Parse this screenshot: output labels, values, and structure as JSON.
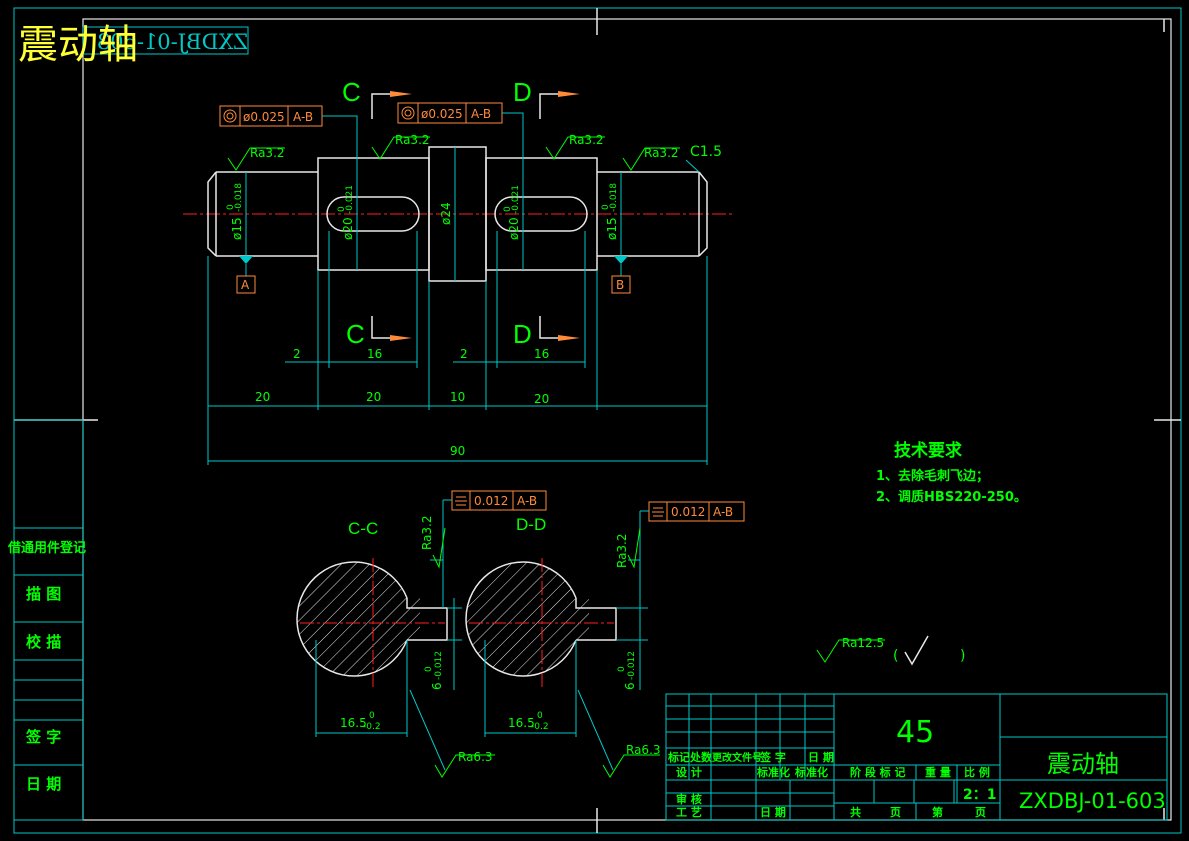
{
  "drawing": {
    "title_overlay": "震动轴",
    "code_mirror": "ZXDBJ-01-603",
    "section_labels": {
      "c": "C",
      "d": "D",
      "cc": "C-C",
      "dd": "D-D"
    },
    "datums": {
      "a": "A",
      "b": "B",
      "ab": "A-B"
    },
    "tolerances": {
      "runout": "ø0.025",
      "symmetry": "0.012"
    },
    "roughness": {
      "ra32": "Ra3.2",
      "ra63": "Ra6.3",
      "ra125": "Ra12.5",
      "chamfer": "C1.5",
      "paren_open": "(",
      "paren_close": ")"
    },
    "diameters": {
      "d15": "ø15",
      "d20": "ø20",
      "d24": "ø24",
      "tol_upper": "0",
      "tol_lower_15": "-0.018",
      "tol_lower_20": "-0.021"
    },
    "dims": {
      "d2": "2",
      "d16": "16",
      "d20": "20",
      "d10": "10",
      "d90": "90",
      "d165": "16.5",
      "d165_tol": "-0.2",
      "d6": "6",
      "d6_tol": "-0.012",
      "zero": "0"
    },
    "tech_req": {
      "title": "技术要求",
      "line1": "1、去除毛刺飞边；",
      "line2": "2、调质HBS220-250。"
    }
  },
  "sidebar": {
    "items": [
      "借通用件登记",
      "描 图",
      "校 描",
      "签 字",
      "日 期"
    ]
  },
  "title_block": {
    "material": "45",
    "name": "震动轴",
    "code": "ZXDBJ-01-603",
    "scale": "2：1",
    "headers": {
      "marks": "标记",
      "count": "处数",
      "change_doc": "更改文件号",
      "sign": "签 字",
      "date": "日 期",
      "design": "设 计",
      "std": "标准化",
      "std2": "标准化",
      "stage": "阶 段 标 记",
      "weight": "重 量",
      "ratio": "比 例",
      "review": "审 核",
      "process": "工 艺",
      "date2": "日 期",
      "total": "共",
      "page": "页",
      "no": "第",
      "page2": "页"
    }
  }
}
